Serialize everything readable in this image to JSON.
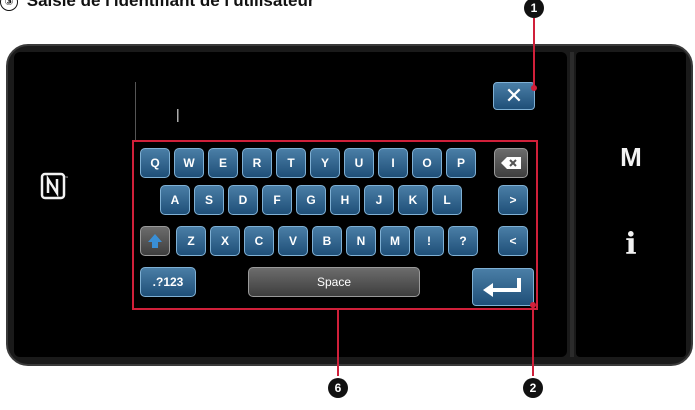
{
  "heading": {
    "number": "③",
    "text": "Saisie de l'identifiant de l'utilisateur"
  },
  "input": {
    "cursor": "|"
  },
  "keyboard": {
    "row1": [
      "Q",
      "W",
      "E",
      "R",
      "T",
      "Y",
      "U",
      "I",
      "O",
      "P"
    ],
    "row2": [
      "A",
      "S",
      "D",
      "F",
      "G",
      "H",
      "J",
      "K",
      "L"
    ],
    "row3": [
      "Z",
      "X",
      "C",
      "V",
      "B",
      "N",
      "M",
      "!",
      "?"
    ],
    "backspace_icon": "backspace-icon",
    "right_arrow": ">",
    "left_arrow": "<",
    "shift_icon": "shift-arrow-icon",
    "symbols_label": ".?123",
    "space_label": "Space",
    "enter_icon": "enter-arrow-icon"
  },
  "close_button": {
    "label": "✕"
  },
  "side_panel": {
    "m_label": "M",
    "i_label": "i"
  },
  "nfc": {
    "icon": "nfc-icon"
  },
  "callouts": {
    "marker_1": "1",
    "marker_2": "2",
    "marker_6": "6"
  },
  "colors": {
    "key_blue": "#2f6590",
    "key_grey": "#555555",
    "highlight_red": "#d0203a"
  }
}
